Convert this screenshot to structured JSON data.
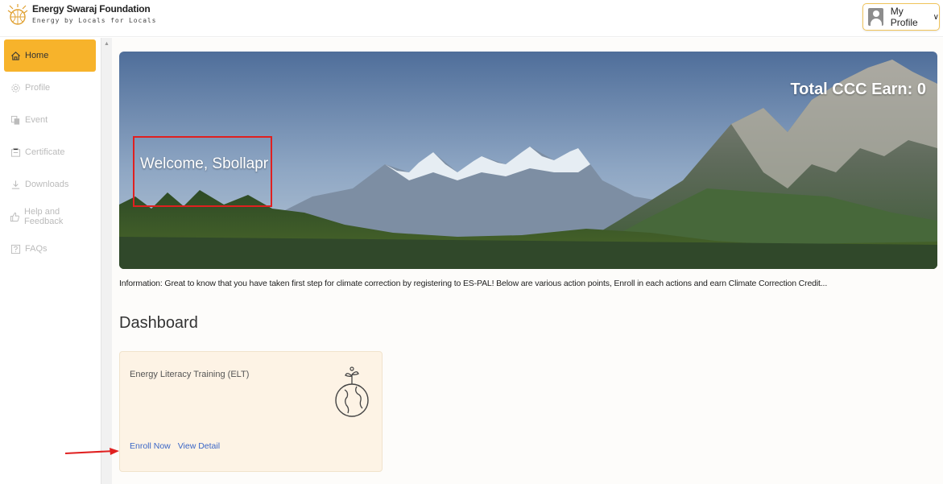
{
  "header": {
    "brand_name": "Energy Swaraj Foundation",
    "brand_tagline": "Energy by Locals for Locals",
    "profile_label": "My Profile",
    "profile_chevron": "∨"
  },
  "sidebar": {
    "items": [
      {
        "label": "Home",
        "icon": "home-icon",
        "active": true
      },
      {
        "label": "Profile",
        "icon": "gear-icon",
        "active": false
      },
      {
        "label": "Event",
        "icon": "copy-icon",
        "active": false
      },
      {
        "label": "Certificate",
        "icon": "certificate-icon",
        "active": false
      },
      {
        "label": "Downloads",
        "icon": "download-icon",
        "active": false
      },
      {
        "label": "Help and Feedback",
        "icon": "thumbs-up-icon",
        "active": false
      },
      {
        "label": "FAQs",
        "icon": "question-icon",
        "active": false
      }
    ]
  },
  "hero": {
    "welcome": "Welcome, Sbollapr",
    "total_ccc": "Total CCC Earn: 0"
  },
  "info": {
    "label": "Information",
    "text": ": Great to know that you have taken first step for climate correction by registering to ES-PAL! Below are various action points, Enroll in each actions and earn Climate Correction Credit..."
  },
  "dashboard": {
    "title": "Dashboard",
    "cards": [
      {
        "title": "Energy Literacy Training (ELT)",
        "icon": "globe-plant-icon",
        "enroll_label": "Enroll Now",
        "detail_label": "View Detail"
      }
    ]
  },
  "colors": {
    "accent": "#f7b32b",
    "link": "#3a66c6",
    "highlight": "#e02020",
    "card_bg": "#fdf3e5"
  }
}
